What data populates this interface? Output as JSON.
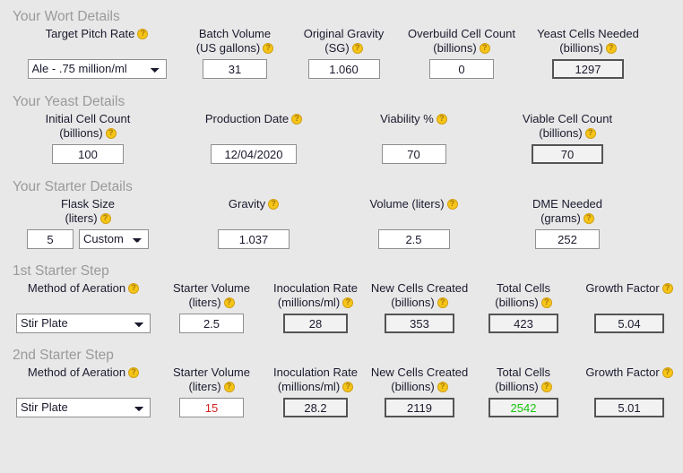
{
  "sections": {
    "wort": {
      "title": "Your Wort Details",
      "fields": {
        "pitch_rate": {
          "label_line1": "Target Pitch Rate",
          "value": "Ale - .75 million/ml",
          "options": [
            "Ale - .75 million/ml"
          ]
        },
        "batch_volume": {
          "label_line1": "Batch Volume",
          "label_line2": "(US gallons)",
          "value": "31"
        },
        "original_gravity": {
          "label_line1": "Original Gravity",
          "label_line2": "(SG)",
          "value": "1.060"
        },
        "overbuild_cell_count": {
          "label_line1": "Overbuild Cell Count",
          "label_line2": "(billions)",
          "value": "0"
        },
        "yeast_cells_needed": {
          "label_line1": "Yeast Cells Needed",
          "label_line2": "(billions)",
          "value": "1297"
        }
      }
    },
    "yeast": {
      "title": "Your Yeast Details",
      "fields": {
        "initial_cell_count": {
          "label_line1": "Initial Cell Count",
          "label_line2": "(billions)",
          "value": "100"
        },
        "production_date": {
          "label_line1": "Production Date",
          "value": "12/04/2020"
        },
        "viability": {
          "label_line1": "Viability %",
          "value": "70"
        },
        "viable_cell_count": {
          "label_line1": "Viable Cell Count",
          "label_line2": "(billions)",
          "value": "70"
        }
      }
    },
    "starter": {
      "title": "Your Starter Details",
      "fields": {
        "flask_size": {
          "label_line1": "Flask Size",
          "label_line2": "(liters)",
          "value": "5",
          "preset": "Custom",
          "preset_options": [
            "Custom"
          ]
        },
        "gravity": {
          "label_line1": "Gravity",
          "value": "1.037"
        },
        "volume": {
          "label_line1": "Volume (liters)",
          "value": "2.5"
        },
        "dme_needed": {
          "label_line1": "DME Needed",
          "label_line2": "(grams)",
          "value": "252"
        }
      }
    },
    "step1": {
      "title": "1st Starter Step",
      "fields": {
        "aeration": {
          "label_line1": "Method of Aeration",
          "value": "Stir Plate",
          "options": [
            "Stir Plate"
          ]
        },
        "starter_volume": {
          "label_line1": "Starter Volume",
          "label_line2": "(liters)",
          "value": "2.5"
        },
        "inoculation_rate": {
          "label_line1": "Inoculation Rate",
          "label_line2": "(millions/ml)",
          "value": "28"
        },
        "new_cells_created": {
          "label_line1": "New Cells Created",
          "label_line2": "(billions)",
          "value": "353"
        },
        "total_cells": {
          "label_line1": "Total Cells",
          "label_line2": "(billions)",
          "value": "423"
        },
        "growth_factor": {
          "label_line1": "Growth Factor",
          "value": "5.04"
        }
      }
    },
    "step2": {
      "title": "2nd Starter Step",
      "fields": {
        "aeration": {
          "label_line1": "Method of Aeration",
          "value": "Stir Plate",
          "options": [
            "Stir Plate"
          ]
        },
        "starter_volume": {
          "label_line1": "Starter Volume",
          "label_line2": "(liters)",
          "value": "15"
        },
        "inoculation_rate": {
          "label_line1": "Inoculation Rate",
          "label_line2": "(millions/ml)",
          "value": "28.2"
        },
        "new_cells_created": {
          "label_line1": "New Cells Created",
          "label_line2": "(billions)",
          "value": "2119"
        },
        "total_cells": {
          "label_line1": "Total Cells",
          "label_line2": "(billions)",
          "value": "2542"
        },
        "growth_factor": {
          "label_line1": "Growth Factor",
          "value": "5.01"
        }
      }
    }
  },
  "icons": {
    "help": "help-icon"
  },
  "colors": {
    "background": "#e8e8e8",
    "section_title": "#9a9a9a",
    "text": "#1a1a2e",
    "help_icon": "#f5c518",
    "warning_value": "#d11f1f",
    "success_value": "#16c60c",
    "field_border": "#8f8f8f",
    "calc_field_border": "#545454"
  }
}
